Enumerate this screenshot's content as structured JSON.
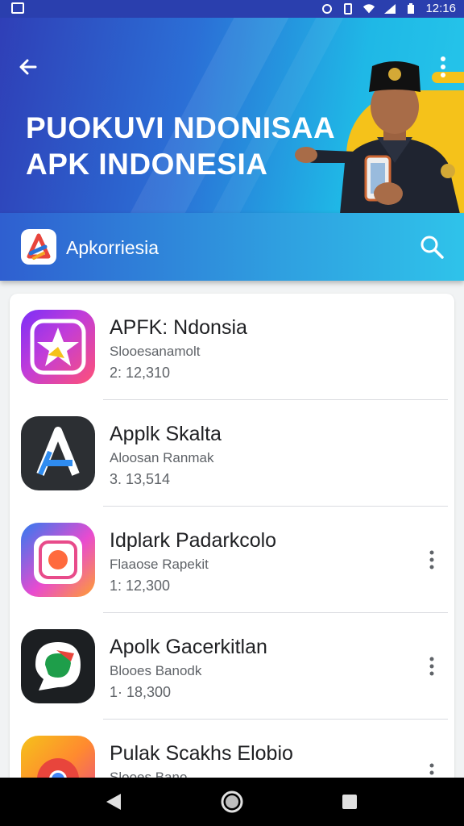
{
  "status_bar": {
    "time": "12:16"
  },
  "hero": {
    "title_line1": "PUOKUVI NDONISAA",
    "title_line2": "APK INDONESIA"
  },
  "app_bar": {
    "app_name": "Apkorriesia"
  },
  "apps": [
    {
      "name": "APFK: Ndonsia",
      "subtitle": "Slooesanamolt",
      "meta": "2: 12,310",
      "icon": "star-app-icon",
      "has_menu": false
    },
    {
      "name": "Applk Skalta",
      "subtitle": "Aloosan Ranmak",
      "meta": "3. 13,514",
      "icon": "a-app-icon",
      "has_menu": false
    },
    {
      "name": "Idplark Padarkcolo",
      "subtitle": "Flaaose Rapekit",
      "meta": "1: 12,300",
      "icon": "camera-app-icon",
      "has_menu": true
    },
    {
      "name": "Apolk Gacerkitlan",
      "subtitle": "Blooes Banodk",
      "meta": "1· 18,300",
      "icon": "chat-app-icon",
      "has_menu": true
    },
    {
      "name": "Pulak Scakhs Elobio",
      "subtitle": "Slooes Bano",
      "meta": "",
      "icon": "chrome-app-icon",
      "has_menu": true
    }
  ],
  "colors": {
    "header_start": "#2f3fb7",
    "header_end": "#26c6ea",
    "accent_yellow": "#f5c21a"
  }
}
